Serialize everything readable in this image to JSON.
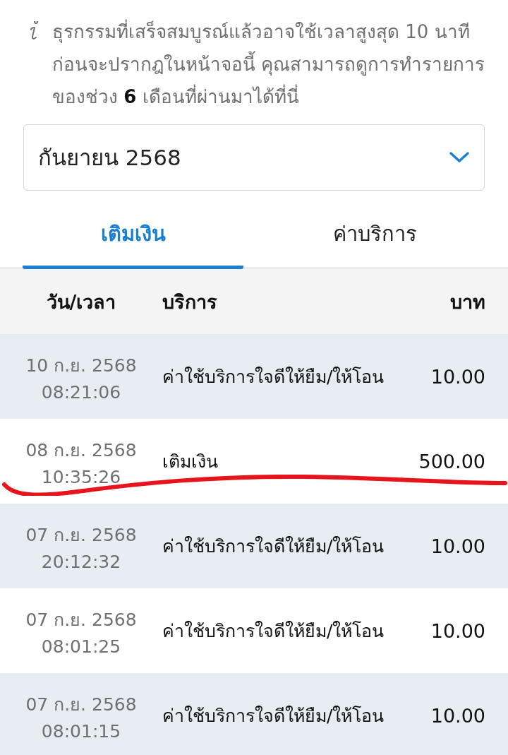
{
  "notice": "ธุรกรรมที่เสร็จสมบูรณ์แล้วอาจใช้เวลาสูงสุด 10 นาทีก่อนจะปรากฎในหน้าจอนี้ คุณสามารถดูการทำรายการของช่วง **6** เดือนที่ผ่านมาได้ที่นี่",
  "month_select": {
    "value": "กันยายน 2568"
  },
  "tabs": [
    {
      "label": "เติมเงิน",
      "selected": true
    },
    {
      "label": "ค่าบริการ",
      "selected": false
    }
  ],
  "table": {
    "columns": [
      "วัน/เวลา",
      "บริการ",
      "บาท"
    ],
    "rows": [
      {
        "date": "10 ก.ย. 2568",
        "time": "08:21:06",
        "service": "ค่าใช้บริการใจดีให้ยืม/ให้โอน",
        "amount": "10.00"
      },
      {
        "date": "08 ก.ย. 2568",
        "time": "10:35:26",
        "service": "เติมเงิน",
        "amount": "500.00"
      },
      {
        "date": "07 ก.ย. 2568",
        "time": "20:12:32",
        "service": "ค่าใช้บริการใจดีให้ยืม/ให้โอน",
        "amount": "10.00"
      },
      {
        "date": "07 ก.ย. 2568",
        "time": "08:01:25",
        "service": "ค่าใช้บริการใจดีให้ยืม/ให้โอน",
        "amount": "10.00"
      },
      {
        "date": "07 ก.ย. 2568",
        "time": "08:01:15",
        "service": "ค่าใช้บริการใจดีให้ยืม/ให้โอน",
        "amount": "10.00"
      }
    ]
  }
}
